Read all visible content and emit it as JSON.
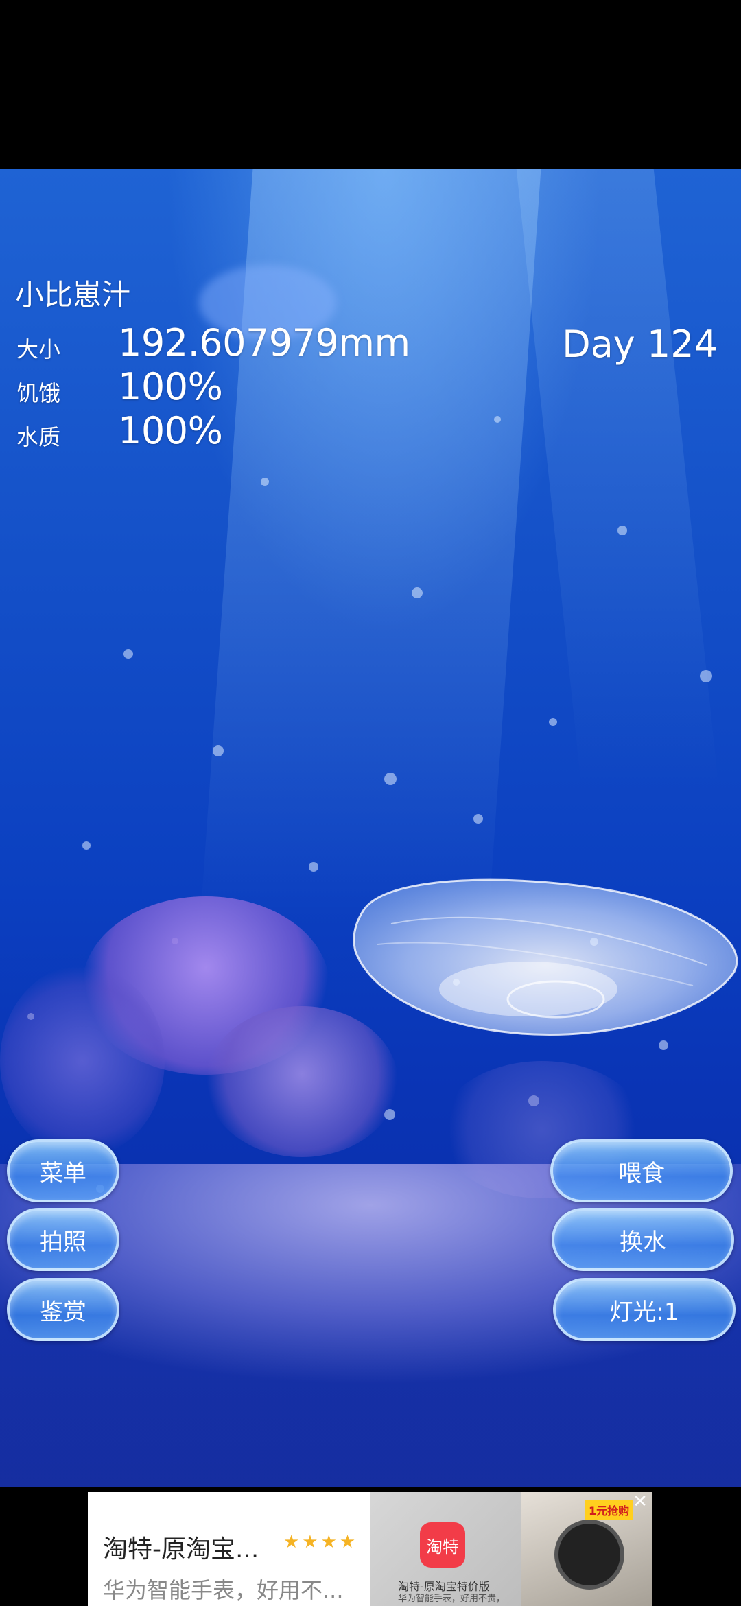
{
  "hud": {
    "title": "小比崽汁",
    "size_label": "大小",
    "size_value": "192.607979mm",
    "hunger_label": "饥饿",
    "hunger_value": "100%",
    "water_label": "水质",
    "water_value": "100%",
    "day": "Day 124"
  },
  "buttons": {
    "menu": "菜单",
    "photo": "拍照",
    "appreciate": "鉴赏",
    "feed": "喂食",
    "change_water": "换水",
    "light": "灯光:1"
  },
  "ad": {
    "title": "淘特-原淘宝...",
    "stars": "★★★★",
    "subtitle": "华为智能手表，好用不...",
    "app_icon_text": "淘特",
    "image_caption": "淘特-原淘宝特价版",
    "image_caption_sub": "华为智能手表，好用不贵，",
    "badge": "1元抢购"
  },
  "colors": {
    "water_top": "#1f63d4",
    "water_bottom": "#0c2a9e",
    "button_fill": "#3c8cf0"
  },
  "icons": {
    "close": "close-icon",
    "jellyfish": "jellyfish-sprite"
  }
}
